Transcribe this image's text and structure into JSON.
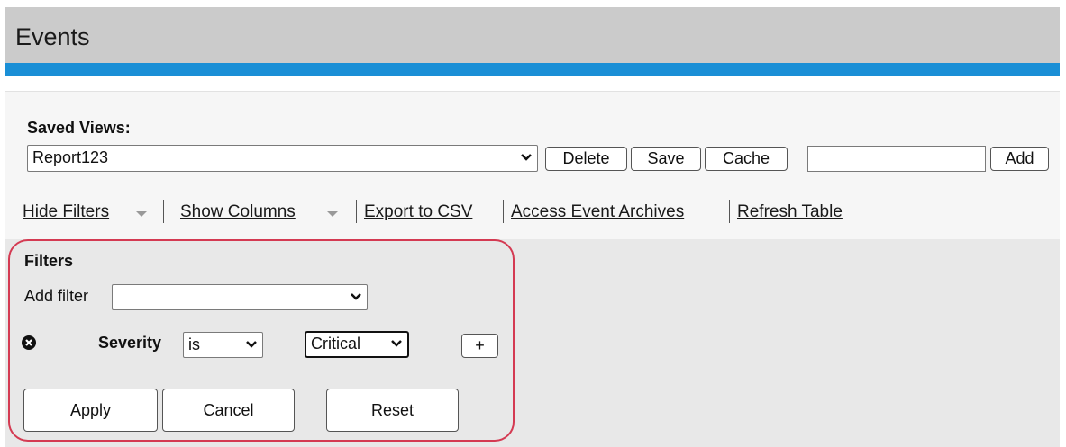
{
  "page": {
    "title": "Events"
  },
  "saved_views": {
    "label": "Saved Views:",
    "selected": "Report123",
    "delete_label": "Delete",
    "save_label": "Save",
    "cache_label": "Cache",
    "new_view_value": "",
    "add_label": "Add"
  },
  "actions": {
    "hide_filters": "Hide Filters",
    "show_columns": "Show Columns",
    "export_csv": "Export to CSV",
    "access_archives": "Access Event Archives",
    "refresh_table": "Refresh Table"
  },
  "filters": {
    "title": "Filters",
    "add_filter_label": "Add filter",
    "add_filter_value": "",
    "rows": [
      {
        "field": "Severity",
        "operator": "is",
        "value": "Critical"
      }
    ],
    "add_row_label": "+",
    "apply_label": "Apply",
    "cancel_label": "Cancel",
    "reset_label": "Reset"
  },
  "colors": {
    "header_bg": "#cbcbcb",
    "accent_bar": "#1a8fd6",
    "highlight_outline": "#d43a52"
  },
  "icons": {
    "dropdown": "chevron-down-icon",
    "remove_filter": "close-circle-icon",
    "menu_caret": "caret-down-icon"
  }
}
